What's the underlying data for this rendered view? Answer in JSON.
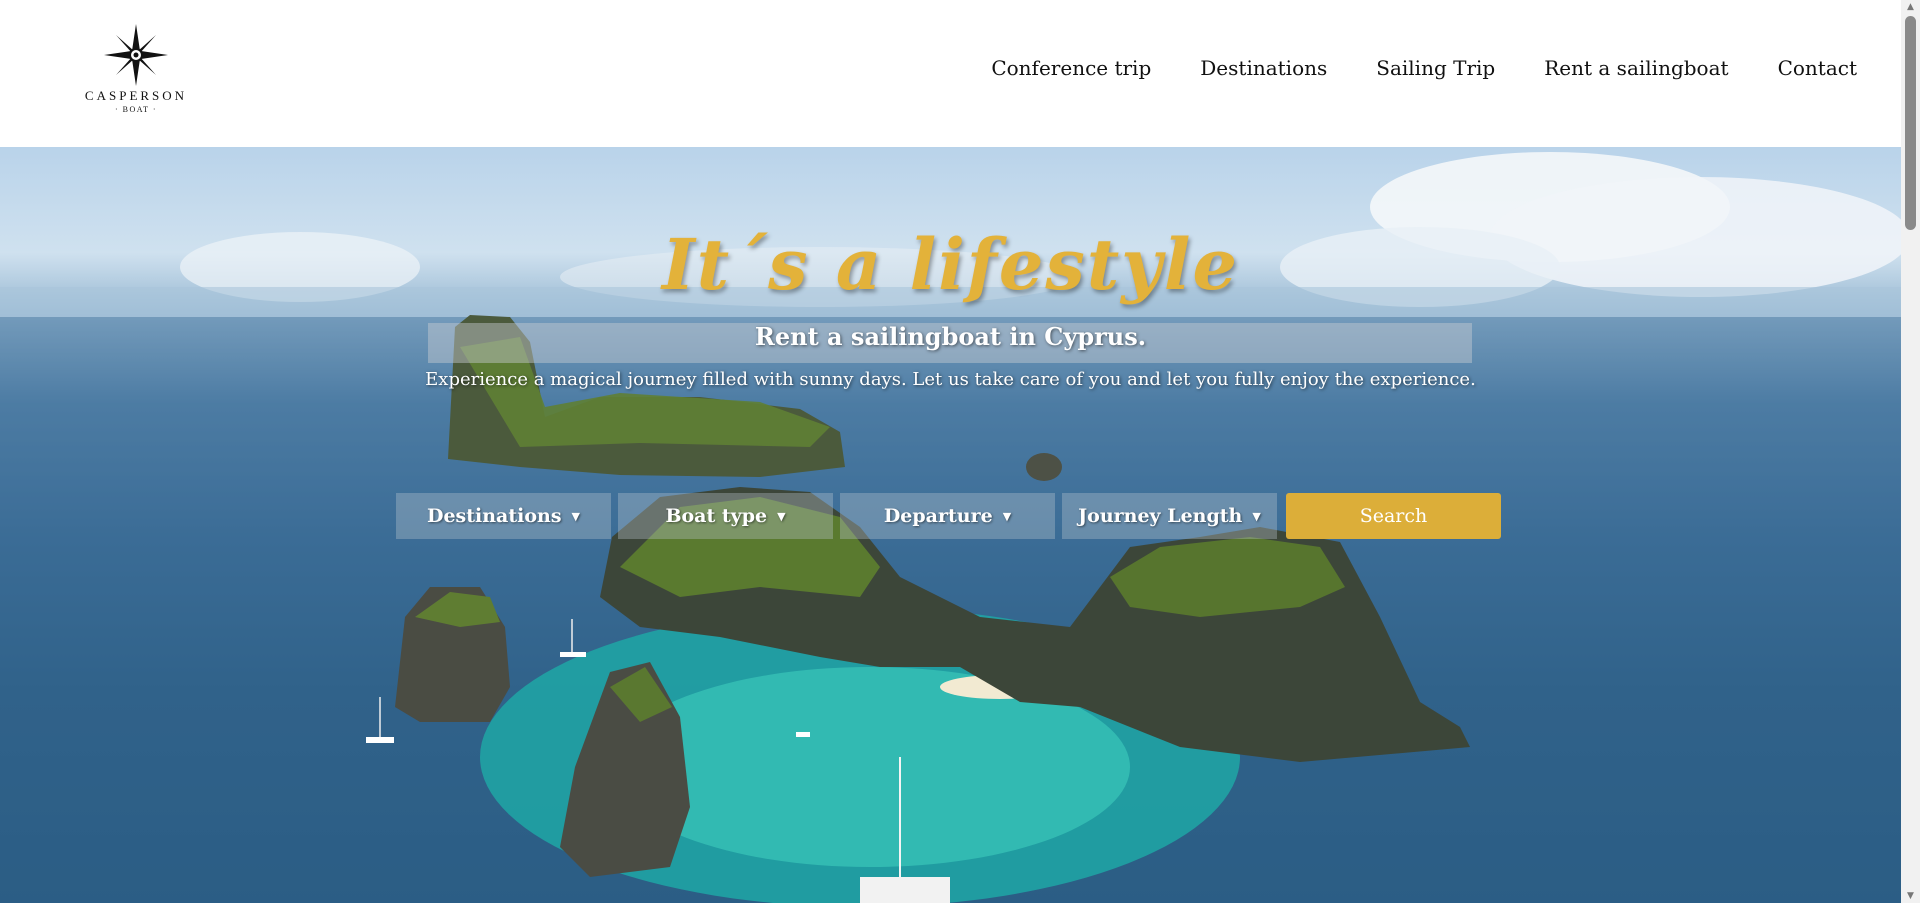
{
  "logo": {
    "brand": "CASPERSON",
    "sub": "· BOAT ·",
    "icon": "compass-star-icon"
  },
  "nav": {
    "items": [
      "Conference trip",
      "Destinations",
      "Sailing Trip",
      "Rent a sailingboat",
      "Contact"
    ]
  },
  "hero": {
    "tagline": "It´s a lifestyle",
    "title": "Rent a sailingboat in Cyprus.",
    "text": "Experience a magical journey filled with sunny days. Let us take care of you and let you fully enjoy the experience."
  },
  "filters": {
    "destinations": "Destinations",
    "boat_type": "Boat type",
    "departure": "Departure",
    "journey_length": "Journey Length",
    "search": "Search"
  },
  "colors": {
    "accent": "#dcae39",
    "tagline": "#e3b23a"
  }
}
